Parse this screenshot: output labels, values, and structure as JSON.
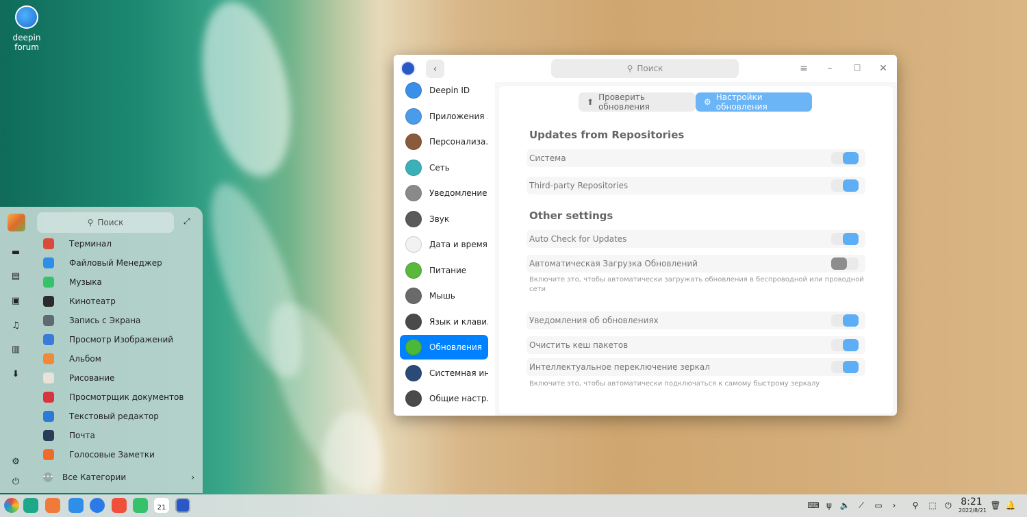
{
  "desktop": {
    "icon_label_1": "deepin",
    "icon_label_2": "forum"
  },
  "launcher": {
    "search_placeholder": "Поиск",
    "apps": [
      {
        "label": "Терминал",
        "color": "#d84a3a"
      },
      {
        "label": "Файловый Менеджер",
        "color": "#2f8fe8"
      },
      {
        "label": "Музыка",
        "color": "#35c26a"
      },
      {
        "label": "Кинотеатр",
        "color": "#2b2b2b"
      },
      {
        "label": "Запись с Экрана",
        "color": "#5f6b73"
      },
      {
        "label": "Просмотр Изображений",
        "color": "#3a7ad8"
      },
      {
        "label": "Альбом",
        "color": "#f08a3a"
      },
      {
        "label": "Рисование",
        "color": "#e8e2d8"
      },
      {
        "label": "Просмотрщик документов",
        "color": "#d8343c"
      },
      {
        "label": "Текстовый редактор",
        "color": "#2a7bd8"
      },
      {
        "label": "Почта",
        "color": "#2a3b58"
      },
      {
        "label": "Голосовые Заметки",
        "color": "#f06a2a"
      }
    ],
    "all_categories": "Все Категории",
    "side_icons": [
      "computer-icon",
      "document-icon",
      "picture-icon",
      "music-icon",
      "video-icon",
      "download-icon",
      "settings-icon",
      "power-icon"
    ]
  },
  "window": {
    "search_placeholder": "Поиск",
    "nav": [
      {
        "label": "Deepin ID",
        "color": "#3a8fe8"
      },
      {
        "label": "Приложения ...",
        "color": "#4a9be8"
      },
      {
        "label": "Персонализа...",
        "color": "#8a5a3a"
      },
      {
        "label": "Сеть",
        "color": "#3ab0b8"
      },
      {
        "label": "Уведомление",
        "color": "#8a8a8a"
      },
      {
        "label": "Звук",
        "color": "#5a5a5a"
      },
      {
        "label": "Дата и время",
        "color": "#f2f2f2"
      },
      {
        "label": "Питание",
        "color": "#5ab83a"
      },
      {
        "label": "Мышь",
        "color": "#6a6a6a"
      },
      {
        "label": "Язык и клави...",
        "color": "#4a4a4a"
      },
      {
        "label": "Обновления",
        "color": "#4cb83a"
      },
      {
        "label": "Системная ин...",
        "color": "#2a4a78"
      },
      {
        "label": "Общие настр...",
        "color": "#4a4a4a"
      }
    ],
    "active_nav": "Обновления",
    "tabs": {
      "check": "Проверить обновления",
      "settings": "Настройки обновления"
    },
    "section1": "Updates from Repositories",
    "system_label": "Система",
    "system_on": true,
    "third_party_label": "Third-party Repositories",
    "third_party_on": true,
    "section2": "Other settings",
    "auto_check_label": "Auto Check for Updates",
    "auto_check_on": true,
    "auto_download_label": "Автоматическая Загрузка Обновлений",
    "auto_download_on": false,
    "auto_download_hint": "Включите это, чтобы автоматически загружать обновления в беспроводной или проводной сети",
    "notify_label": "Уведомления об обновлениях",
    "notify_on": true,
    "clean_cache_label": "Очистить кеш пакетов",
    "clean_cache_on": true,
    "mirror_label": "Интеллектуальное переключение зеркал",
    "mirror_on": true,
    "mirror_hint": "Включите это, чтобы автоматически подключаться к самому быстрому зеркалу"
  },
  "dock": {
    "time": "8:21",
    "date": "2022/8/21",
    "calendar_day": "21"
  }
}
